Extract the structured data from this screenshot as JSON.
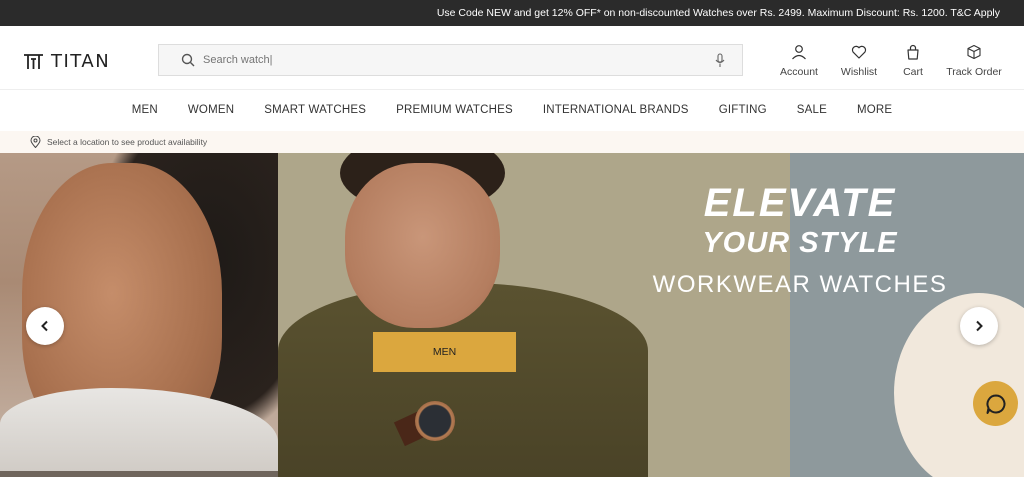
{
  "promo": {
    "text": "Use Code NEW and get 12% OFF* on non-discounted Watches over Rs. 2499. Maximum Discount: Rs. 1200. T&C Apply"
  },
  "brand": {
    "name": "TITAN"
  },
  "search": {
    "placeholder": "Search watch|",
    "value": ""
  },
  "header_actions": [
    {
      "label": "Account",
      "icon": "user-icon"
    },
    {
      "label": "Wishlist",
      "icon": "heart-icon"
    },
    {
      "label": "Cart",
      "icon": "bag-icon"
    },
    {
      "label": "Track Order",
      "icon": "box-icon"
    }
  ],
  "nav": [
    "MEN",
    "WOMEN",
    "SMART WATCHES",
    "PREMIUM WATCHES",
    "INTERNATIONAL BRANDS",
    "GIFTING",
    "SALE",
    "MORE"
  ],
  "location": {
    "text": "Select a location to see product availability",
    "icon": "map-pin-icon"
  },
  "hero": {
    "title": "ELEVATE",
    "subtitle": "YOUR STYLE",
    "tagline": "WORKWEAR WATCHES",
    "cta": "MEN"
  },
  "colors": {
    "accent": "#dba73e",
    "promo_bg": "#2b2b2b",
    "location_bg": "#fcf7f2"
  }
}
